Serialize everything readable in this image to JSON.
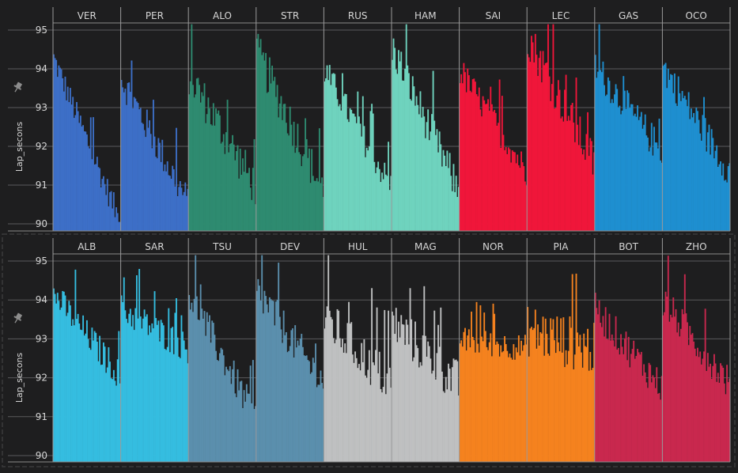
{
  "chart_data": [
    {
      "type": "bar",
      "ylabel": "Lap_secons",
      "ylim": [
        90,
        95.2
      ],
      "yticks": [
        90,
        91,
        92,
        93,
        94,
        95
      ],
      "grid": true,
      "series": [
        {
          "name": "VER",
          "color": "#3d6fc7",
          "start": 94.3,
          "end": 90.1,
          "noise": 0.35
        },
        {
          "name": "PER",
          "color": "#3d6fc7",
          "start": 93.8,
          "end": 90.6,
          "noise": 0.45
        },
        {
          "name": "ALO",
          "color": "#2e8b70",
          "start": 93.9,
          "end": 91.0,
          "noise": 0.55
        },
        {
          "name": "STR",
          "color": "#2e8b70",
          "start": 94.5,
          "end": 90.9,
          "noise": 0.55
        },
        {
          "name": "RUS",
          "color": "#6fd3be",
          "start": 94.0,
          "end": 91.0,
          "noise": 0.4
        },
        {
          "name": "HAM",
          "color": "#6fd3be",
          "start": 94.6,
          "end": 90.9,
          "noise": 0.5
        },
        {
          "name": "SAI",
          "color": "#f0163a",
          "start": 94.0,
          "end": 91.4,
          "noise": 0.4
        },
        {
          "name": "LEC",
          "color": "#f0163a",
          "start": 94.9,
          "end": 91.6,
          "noise": 0.55
        },
        {
          "name": "GAS",
          "color": "#1e8fd0",
          "start": 94.1,
          "end": 91.9,
          "noise": 0.45
        },
        {
          "name": "OCO",
          "color": "#1e8fd0",
          "start": 94.1,
          "end": 91.4,
          "noise": 0.45
        }
      ]
    },
    {
      "type": "bar",
      "ylabel": "Lap_secons",
      "ylim": [
        90,
        95.2
      ],
      "yticks": [
        90,
        91,
        92,
        93,
        94,
        95
      ],
      "grid": true,
      "series": [
        {
          "name": "ALB",
          "color": "#35bde0",
          "start": 94.2,
          "end": 92.1,
          "noise": 0.4
        },
        {
          "name": "SAR",
          "color": "#35bde0",
          "start": 93.8,
          "end": 92.8,
          "noise": 0.4
        },
        {
          "name": "TSU",
          "color": "#5b8fad",
          "start": 94.2,
          "end": 91.0,
          "noise": 0.45
        },
        {
          "name": "DEV",
          "color": "#5b8fad",
          "start": 94.3,
          "end": 91.9,
          "noise": 0.5
        },
        {
          "name": "HUL",
          "color": "#bfc0c1",
          "start": 93.6,
          "end": 91.9,
          "noise": 0.6
        },
        {
          "name": "MAG",
          "color": "#bfc0c1",
          "start": 93.5,
          "end": 91.9,
          "noise": 0.6
        },
        {
          "name": "NOR",
          "color": "#f5821f",
          "start": 93.0,
          "end": 92.8,
          "noise": 0.35
        },
        {
          "name": "PIA",
          "color": "#f5821f",
          "start": 93.3,
          "end": 92.8,
          "noise": 0.7
        },
        {
          "name": "BOT",
          "color": "#c9284e",
          "start": 93.8,
          "end": 91.8,
          "noise": 0.45
        },
        {
          "name": "ZHO",
          "color": "#c9284e",
          "start": 94.0,
          "end": 91.9,
          "noise": 0.45
        }
      ]
    }
  ],
  "ui": {
    "pin_icon": "pin-icon"
  }
}
